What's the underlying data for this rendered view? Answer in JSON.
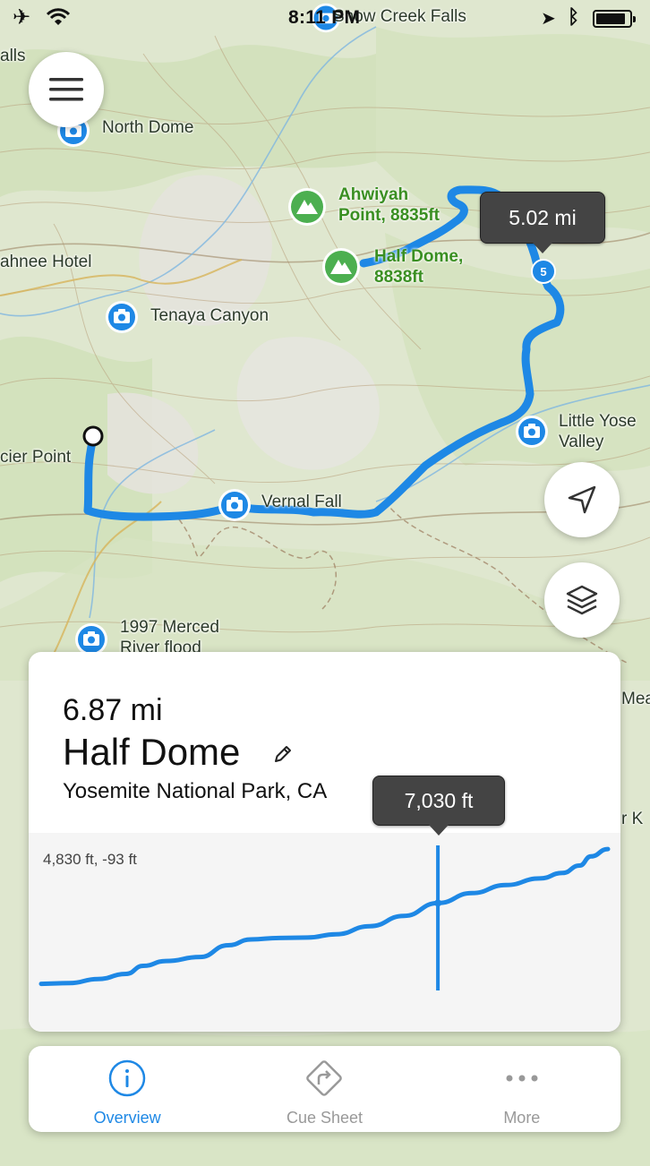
{
  "status_bar": {
    "time": "8:11 PM",
    "battery_level": 0.88
  },
  "map": {
    "labels": {
      "falls": "alls",
      "snow_creek": "Snow Creek Falls",
      "north_dome": "North Dome",
      "ahwahnee": "ahnee Hotel",
      "tenaya": "Tenaya Canyon",
      "glacier_point": "cier Point",
      "little_yosemite_1": "Little Yose",
      "little_yosemite_2": "Valley",
      "vernal_fall": "Vernal Fall",
      "merced_1": "1997 Merced",
      "merced_2": "River flood",
      "edge_mea": "Mea",
      "edge_rk": "r K"
    },
    "peaks": [
      {
        "line1": "Ahwiyah",
        "line2": "Point, 8835ft"
      },
      {
        "line1": "Half Dome,",
        "line2": "8838ft"
      }
    ],
    "marker_number": "5",
    "distance_tooltip": "5.02 mi"
  },
  "route_card": {
    "distance": "6.87 mi",
    "title": "Half Dome",
    "location": "Yosemite National Park, CA",
    "elevation_tooltip": "7,030 ft",
    "elevation_info": "4,830 ft, -93 ft"
  },
  "chart_data": {
    "type": "line",
    "title": "",
    "xlabel": "",
    "ylabel": "",
    "x": [
      0,
      0.05,
      0.1,
      0.15,
      0.18,
      0.22,
      0.28,
      0.33,
      0.37,
      0.42,
      0.47,
      0.52,
      0.58,
      0.64,
      0.7,
      0.76,
      0.82,
      0.88,
      0.92,
      0.95,
      0.97,
      1.0
    ],
    "series": [
      {
        "values": [
          4830,
          4850,
          4960,
          5100,
          5320,
          5450,
          5560,
          5880,
          6040,
          6080,
          6090,
          6180,
          6400,
          6680,
          7030,
          7300,
          7520,
          7700,
          7850,
          8050,
          8300,
          8500
        ]
      }
    ],
    "cursor_x": 0.7,
    "cursor_value": "7,030 ft"
  },
  "tabs": [
    {
      "label": "Overview",
      "icon": "info-circle-icon",
      "active": true
    },
    {
      "label": "Cue Sheet",
      "icon": "turn-sign-icon",
      "active": false
    },
    {
      "label": "More",
      "icon": "more-dots-icon",
      "active": false
    }
  ],
  "colors": {
    "route": "#1e88e5",
    "peak": "#4caf50",
    "active_tab": "#1e88e5",
    "tooltip": "#444444"
  }
}
